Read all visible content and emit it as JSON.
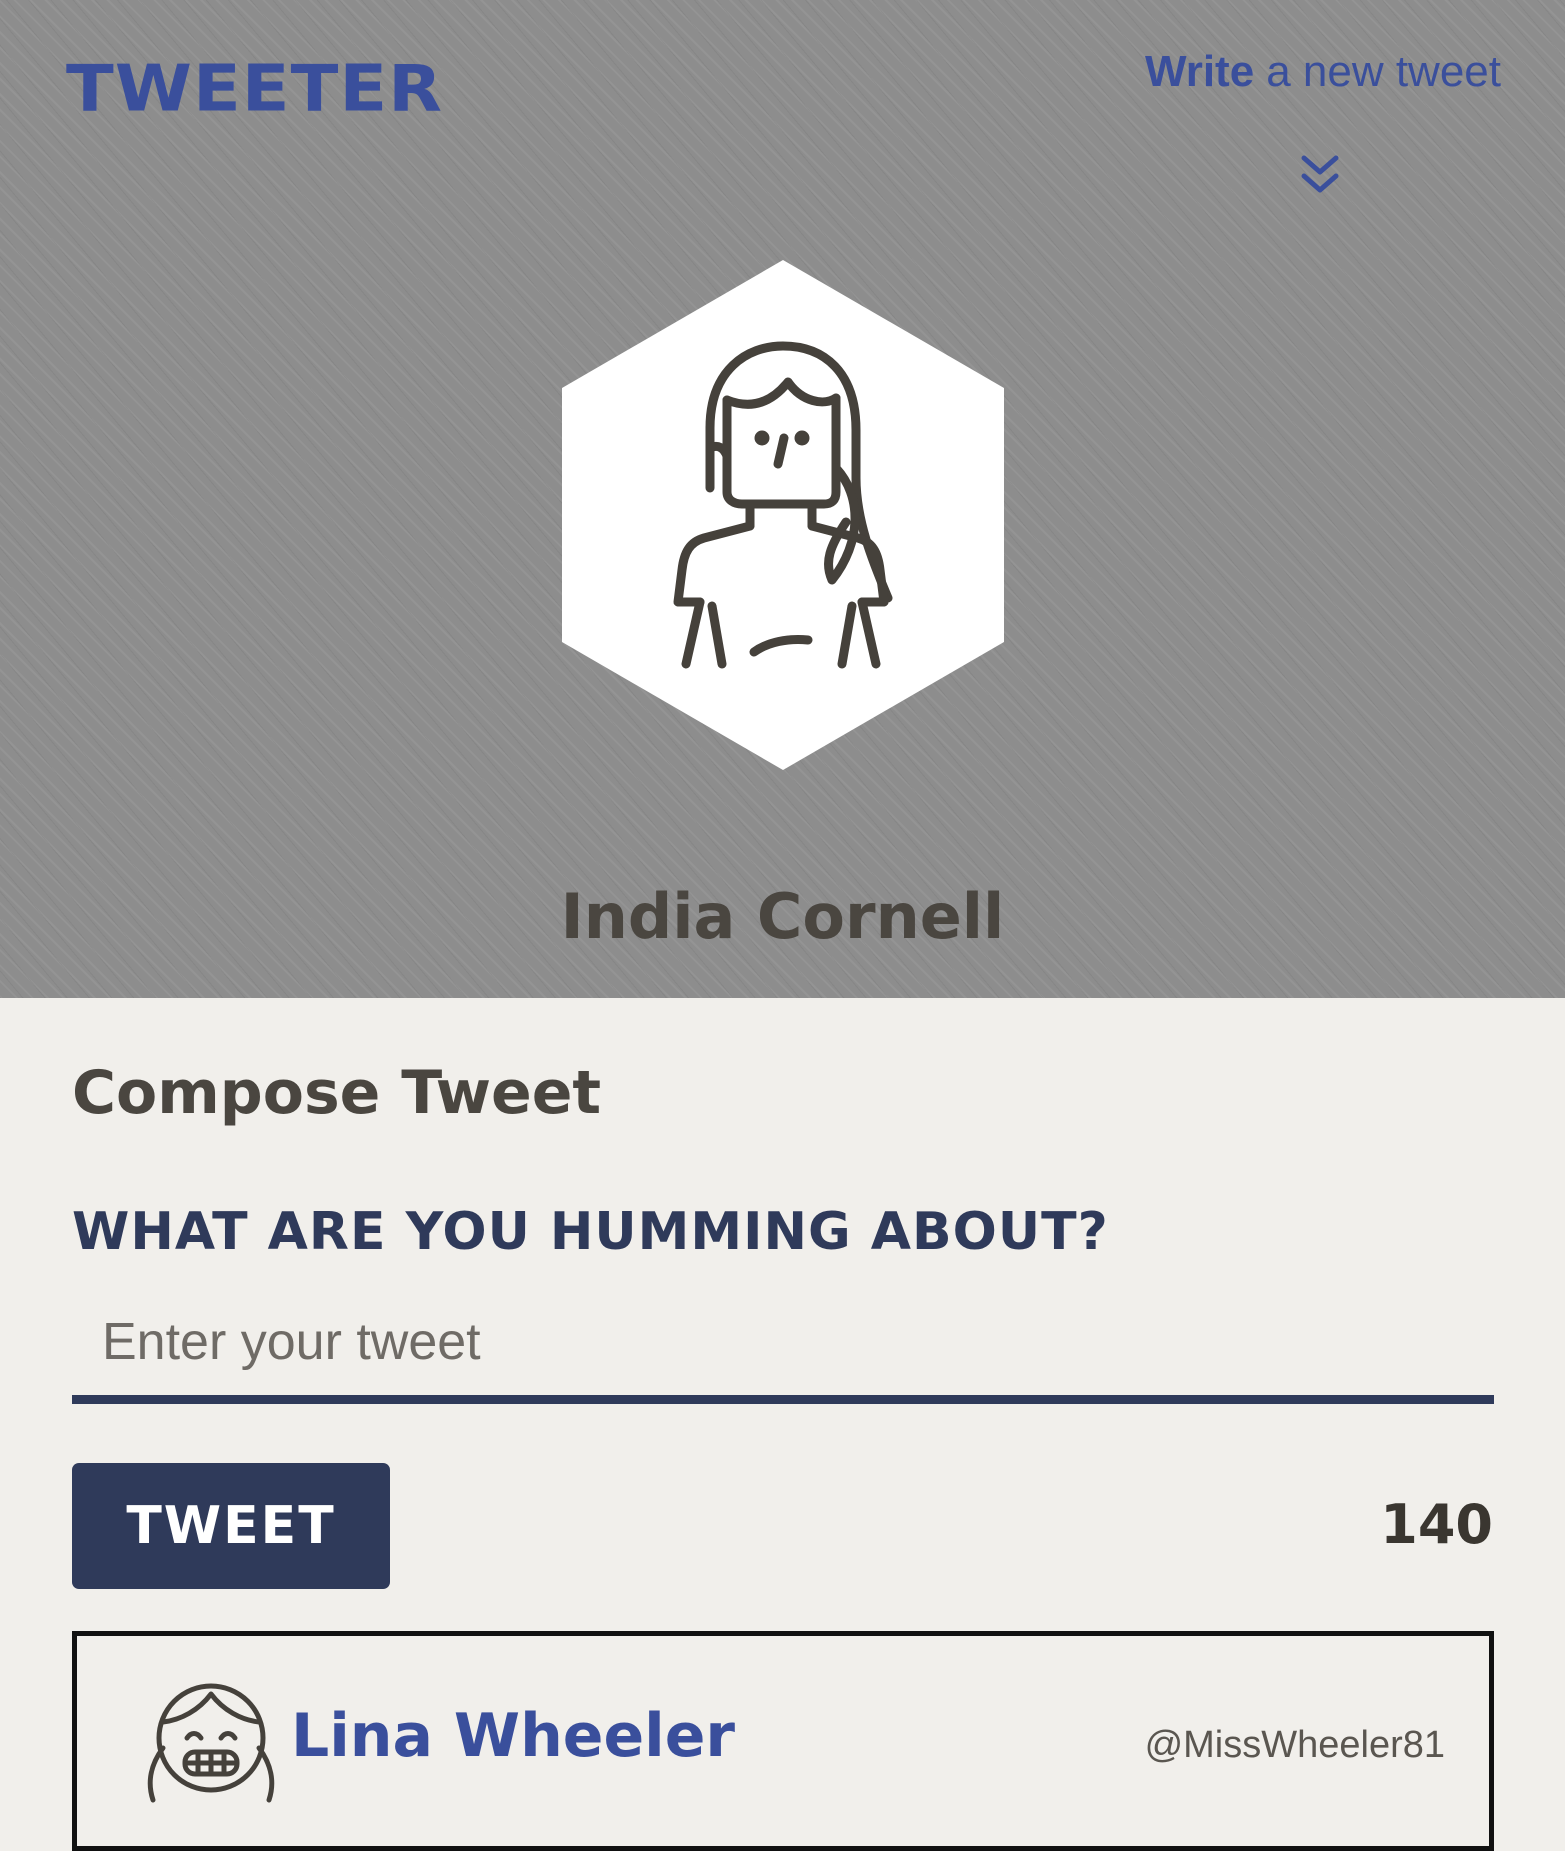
{
  "header": {
    "brand": "TWEETER",
    "write_label": "Write",
    "write_suffix": "a new tweet",
    "toggle_icon": "double-chevron-down-icon",
    "accent_color": "#3a4f9c"
  },
  "profile": {
    "name": "India Cornell",
    "avatar_icon": "woman-avatar-icon"
  },
  "compose": {
    "title": "Compose Tweet",
    "prompt": "What are you humming about?",
    "input_value": "",
    "input_placeholder": "Enter your tweet",
    "button_label": "TWEET",
    "char_count": "140",
    "button_color": "#2f3a5a"
  },
  "tweets": [
    {
      "name": "Lina Wheeler",
      "handle": "@MissWheeler81",
      "avatar_icon": "girl-avatar-icon"
    }
  ]
}
